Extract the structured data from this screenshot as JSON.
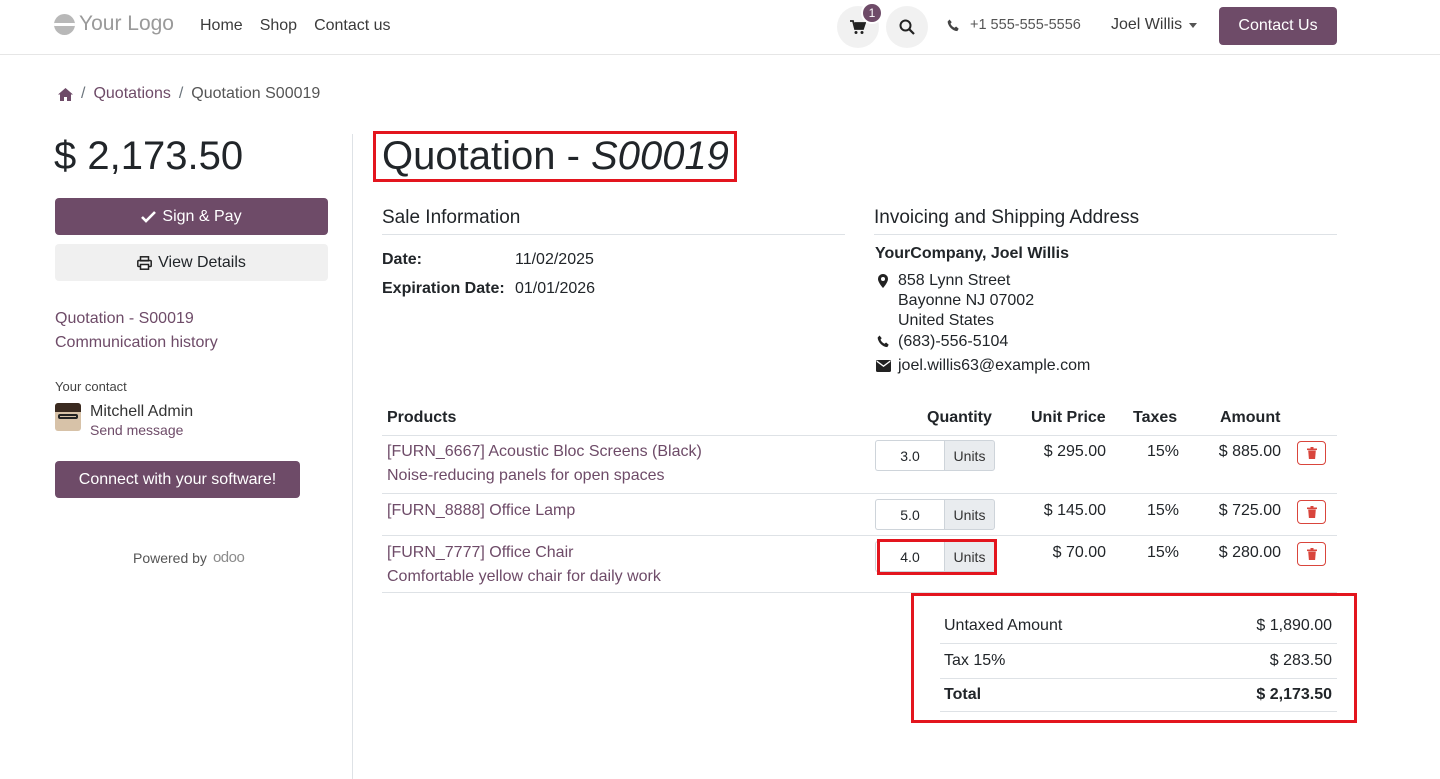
{
  "nav": {
    "logo": "Your Logo",
    "links": [
      "Home",
      "Shop",
      "Contact us"
    ],
    "cart_count": "1",
    "phone": "+1 555-555-5556",
    "user": "Joel Willis",
    "contact_button": "Contact Us"
  },
  "breadcrumb": {
    "items": [
      "Quotations",
      "Quotation S00019"
    ]
  },
  "sidebar": {
    "amount": "$ 2,173.50",
    "sign_pay": "Sign & Pay",
    "view_details": "View Details",
    "links": [
      "Quotation - S00019",
      "Communication history"
    ],
    "your_contact_label": "Your contact",
    "contact_name": "Mitchell Admin",
    "send_message": "Send message",
    "connect_button": "Connect with your software!",
    "powered_by": "Powered by",
    "powered_brand": "odoo"
  },
  "main": {
    "title_prefix": "Quotation - ",
    "title_ref": "S00019",
    "sale_info": {
      "heading": "Sale Information",
      "date_label": "Date:",
      "date_value": "11/02/2025",
      "expiration_label": "Expiration Date:",
      "expiration_value": "01/01/2026"
    },
    "address": {
      "heading": "Invoicing and Shipping Address",
      "name": "YourCompany, Joel Willis",
      "street": "858 Lynn Street",
      "city": "Bayonne NJ 07002",
      "country": "United States",
      "phone": "(683)-556-5104",
      "email": "joel.willis63@example.com"
    },
    "table": {
      "headers": {
        "products": "Products",
        "quantity": "Quantity",
        "unit_price": "Unit Price",
        "taxes": "Taxes",
        "amount": "Amount"
      },
      "rows": [
        {
          "name": "[FURN_6667] Acoustic Bloc Screens (Black)",
          "desc": "Noise-reducing panels for open spaces",
          "qty": "3.0",
          "unit": "Units",
          "price": "$ 295.00",
          "tax": "15%",
          "amount": "$ 885.00"
        },
        {
          "name": "[FURN_8888] Office Lamp",
          "desc": "",
          "qty": "5.0",
          "unit": "Units",
          "price": "$ 145.00",
          "tax": "15%",
          "amount": "$ 725.00"
        },
        {
          "name": "[FURN_7777] Office Chair",
          "desc": "Comfortable yellow chair for daily work",
          "qty": "4.0",
          "unit": "Units",
          "price": "$ 70.00",
          "tax": "15%",
          "amount": "$ 280.00"
        }
      ]
    },
    "totals": {
      "untaxed_label": "Untaxed Amount",
      "untaxed_value": "$ 1,890.00",
      "tax_label": "Tax 15%",
      "tax_value": "$ 283.50",
      "total_label": "Total",
      "total_value": "$ 2,173.50"
    }
  },
  "colors": {
    "brand": "#6e4b68",
    "highlight": "#e3151e",
    "delete": "#d9453c"
  }
}
